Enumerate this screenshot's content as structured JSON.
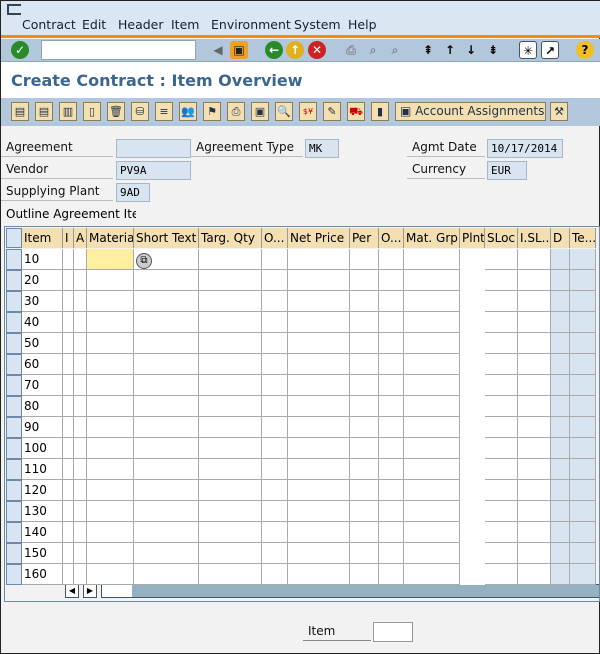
{
  "menu": [
    "Contract",
    "Edit",
    "Header",
    "Item",
    "Environment",
    "System",
    "Help"
  ],
  "title": "Create Contract : Item Overview",
  "command_field": "",
  "app_toolbar": {
    "account_assignments": "Account Assignments"
  },
  "header": {
    "agreement_label": "Agreement",
    "agreement": "",
    "agreement_type_label": "Agreement Type",
    "agreement_type": "MK",
    "agmt_date_label": "Agmt Date",
    "agmt_date": "10/17/2014",
    "vendor_label": "Vendor",
    "vendor": "PV9A",
    "currency_label": "Currency",
    "currency": "EUR",
    "supplying_plant_label": "Supplying Plant",
    "supplying_plant": "9AD",
    "section_label": "Outline Agreement Iter"
  },
  "table": {
    "columns": [
      "Item",
      "I",
      "A",
      "Material",
      "Short Text",
      "Targ. Qty",
      "O...",
      "Net Price",
      "Per",
      "O...",
      "Mat. Grp",
      "Plnt",
      "SLoc",
      "I.SL...",
      "D",
      "Te..."
    ],
    "rows": [
      "10",
      "20",
      "30",
      "40",
      "50",
      "60",
      "70",
      "80",
      "90",
      "100",
      "110",
      "120",
      "130",
      "140",
      "150",
      "160"
    ]
  },
  "footer": {
    "item_label": "Item",
    "item_value": ""
  },
  "colors": {
    "accent": "#f08a1c",
    "title": "#3b6690",
    "toolbar": "#b3c7dc",
    "header_cell": "#f3dfb2",
    "input_highlight": "#fff0a0"
  }
}
